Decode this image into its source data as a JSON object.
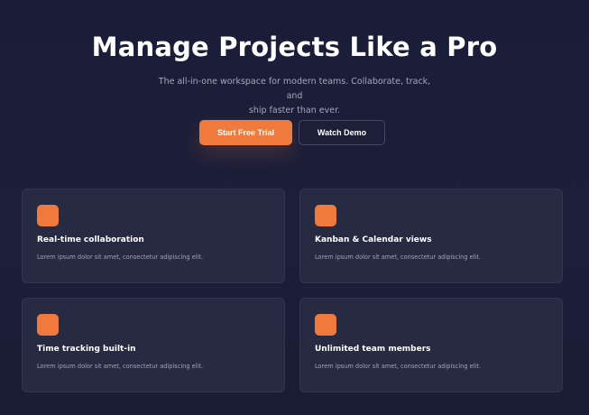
{
  "hero": {
    "title": "Manage Projects Like a Pro",
    "subtitle_line1": "The all-in-one workspace for modern teams. Collaborate, track, and",
    "subtitle_line2": "ship faster than ever.",
    "primary_cta": "Start Free Trial",
    "secondary_cta": "Watch Demo"
  },
  "features": [
    {
      "icon": "feature-icon",
      "title": "Real-time collaboration",
      "description": "Lorem ipsum dolor sit amet, consectetur adipiscing elit."
    },
    {
      "icon": "feature-icon",
      "title": "Kanban & Calendar views",
      "description": "Lorem ipsum dolor sit amet, consectetur adipiscing elit."
    },
    {
      "icon": "feature-icon",
      "title": "Time tracking built-in",
      "description": "Lorem ipsum dolor sit amet, consectetur adipiscing elit."
    },
    {
      "icon": "feature-icon",
      "title": "Unlimited team members",
      "description": "Lorem ipsum dolor sit amet, consectetur adipiscing elit."
    }
  ],
  "colors": {
    "background": "#1b1d38",
    "accent": "#f07a3e",
    "card": "#262a42",
    "muted_text": "#a5a8bb"
  }
}
